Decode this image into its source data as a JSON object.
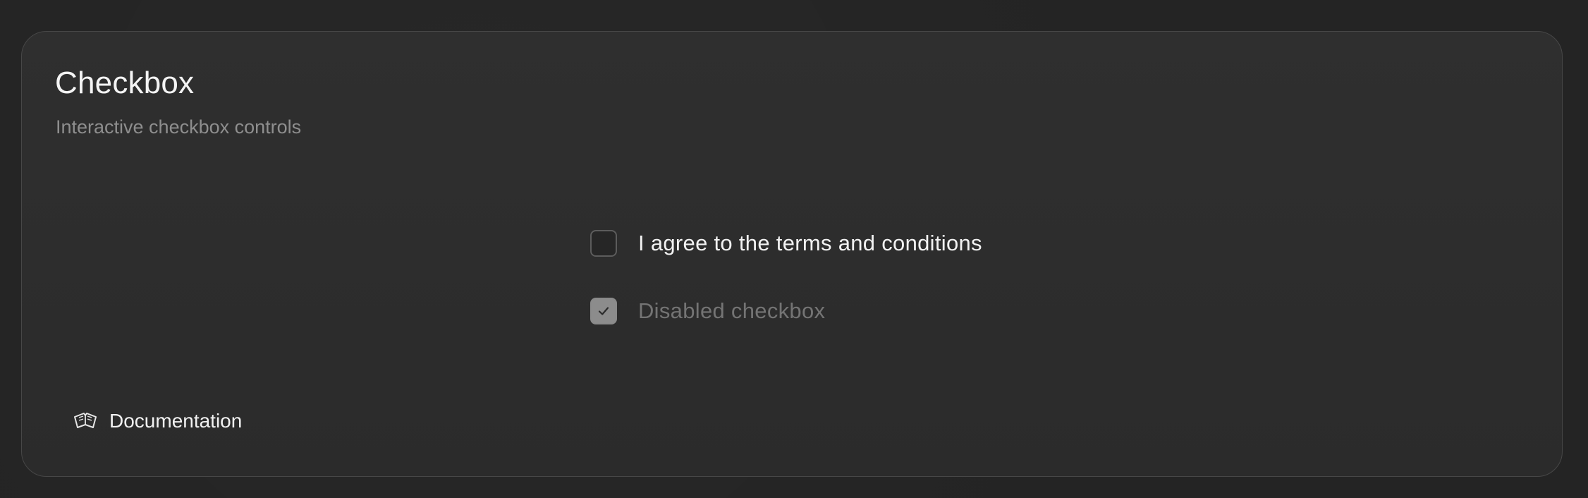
{
  "card": {
    "title": "Checkbox",
    "subtitle": "Interactive checkbox controls"
  },
  "checkboxes": [
    {
      "label": "I agree to the terms and conditions",
      "checked": false,
      "disabled": false
    },
    {
      "label": "Disabled checkbox",
      "checked": true,
      "disabled": true
    }
  ],
  "docs": {
    "label": "Documentation",
    "icon": "book-open-icon"
  },
  "colors": {
    "background": "#242424",
    "card": "#2e2e2e",
    "text": "#f2f2f2",
    "muted": "#8e8e8e",
    "disabled": "#747474"
  }
}
